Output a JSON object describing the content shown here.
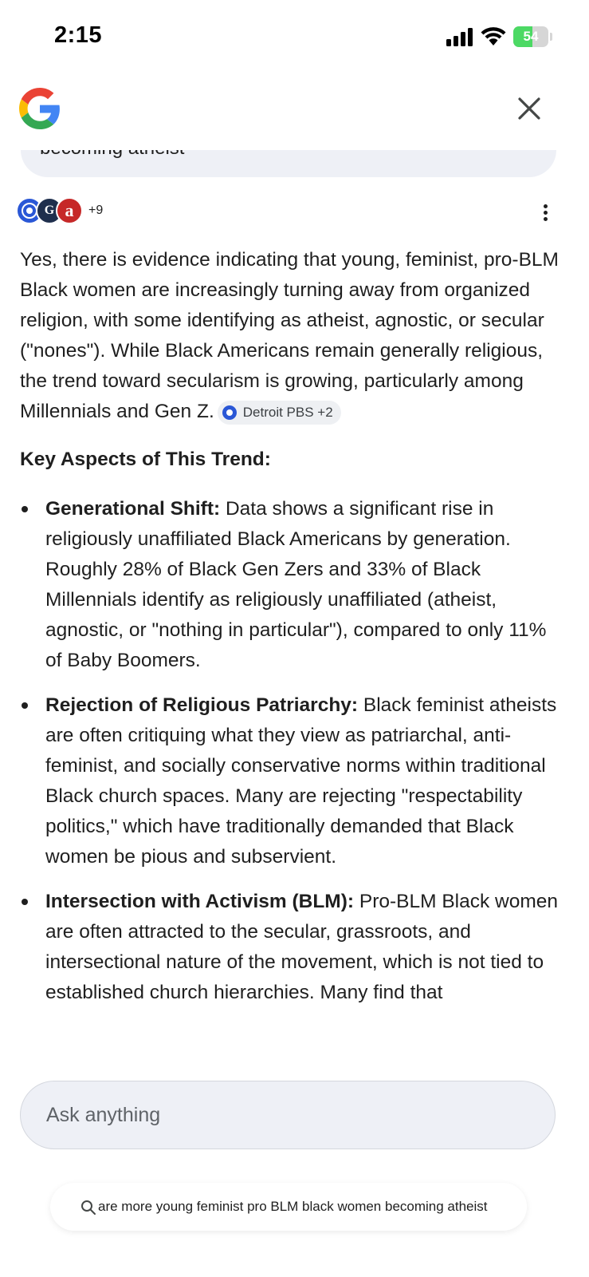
{
  "status_bar": {
    "time": "2:15",
    "battery_percent": "54",
    "battery_level": 0.54,
    "charging": true
  },
  "header": {
    "logo_icon": "google-g-icon",
    "close_icon": "close-icon"
  },
  "query": {
    "text_visible": "becoming atheist"
  },
  "sources": {
    "more_count": "+9",
    "menu_icon": "more-vert-icon"
  },
  "answer": {
    "intro": "Yes, there is evidence indicating that young, feminist, pro-BLM Black women are increasingly turning away from organized religion, with some identifying as atheist, agnostic, or secular (\"nones\"). While Black Americans remain generally religious, the trend toward secularism is growing, particularly among Millennials and Gen Z.",
    "citation_chip": "Detroit PBS +2",
    "heading": "Key Aspects of This Trend:",
    "bullets": [
      {
        "title": "Generational Shift:",
        "text": " Data shows a significant rise in religiously unaffiliated Black Americans by generation. Roughly 28% of Black Gen Zers and 33% of Black Millennials identify as religiously unaffiliated (atheist, agnostic, or \"nothing in particular\"), compared to only 11% of Baby Boomers."
      },
      {
        "title": "Rejection of Religious Patriarchy:",
        "text": " Black feminist atheists are often critiquing what they view as patriarchal, anti-feminist, and socially conservative norms within traditional Black church spaces. Many are rejecting \"respectability politics,\" which have traditionally demanded that Black women be pious and subservient."
      },
      {
        "title": "Intersection with Activism (BLM):",
        "text": " Pro-BLM Black women are often attracted to the secular, grassroots, and intersectional nature of the movement, which is not tied to established church hierarchies. Many find that"
      }
    ]
  },
  "ask": {
    "placeholder": "Ask anything"
  },
  "bottom_search": {
    "text": "are more young feminist pro BLM black women becoming atheist"
  },
  "colors": {
    "chip_blue": "#2a57d6",
    "input_bg": "#eef0f6",
    "battery_green": "#4cd964"
  }
}
